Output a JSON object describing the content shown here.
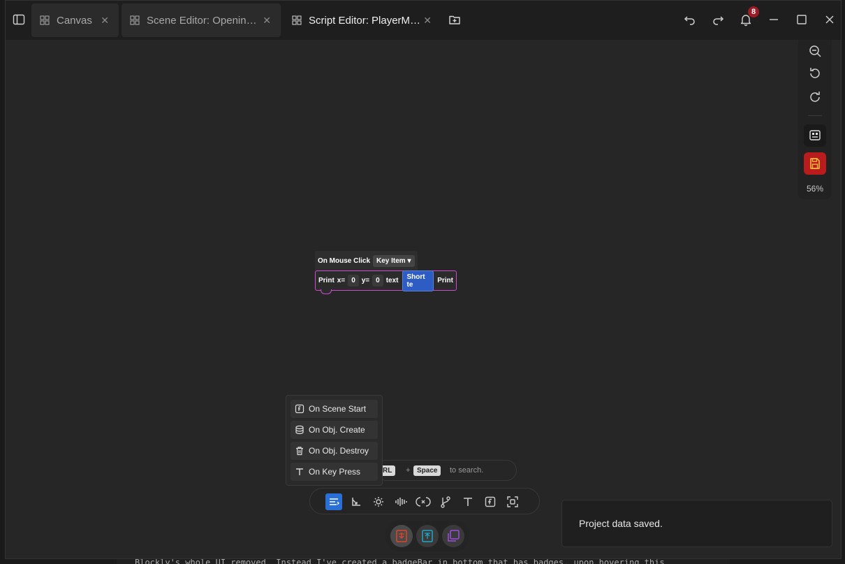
{
  "tabs": [
    {
      "label": "Canvas",
      "icon": "grid-icon"
    },
    {
      "label": "Scene Editor: Openin…",
      "icon": "grid-icon"
    },
    {
      "label": "Script Editor: PlayerM…",
      "icon": "grid-icon"
    }
  ],
  "notifications": {
    "count": "8"
  },
  "zoom": {
    "level": "56%"
  },
  "blocks": {
    "event": {
      "label": "On Mouse Click",
      "dropdown": "Key Item"
    },
    "print": {
      "label": "Print",
      "x_label": "x=",
      "x_value": "0",
      "y_label": "y=",
      "y_value": "0",
      "text_label": "text",
      "text_value": "Short te",
      "tail": "Print"
    }
  },
  "menu": {
    "items": [
      {
        "label": "On Scene Start",
        "icon": "function-icon"
      },
      {
        "label": "On Obj. Create",
        "icon": "database-icon"
      },
      {
        "label": "On Obj. Destroy",
        "icon": "trash-icon"
      },
      {
        "label": "On Key Press",
        "icon": "text-icon"
      }
    ]
  },
  "search_hint": {
    "key1": "RL",
    "plus": "+",
    "key2": "Space",
    "text": "to search."
  },
  "toast": {
    "message": "Project data saved."
  },
  "background_text": "Blockly's whole UI removed. Instead I've created a badgeBar in bottom that has badges, upon hovering this",
  "colors": {
    "accent": "#2a6fd6",
    "save": "#b91c1c",
    "block_outline": "#d04ad0",
    "badge_red": "#9b1c25"
  }
}
